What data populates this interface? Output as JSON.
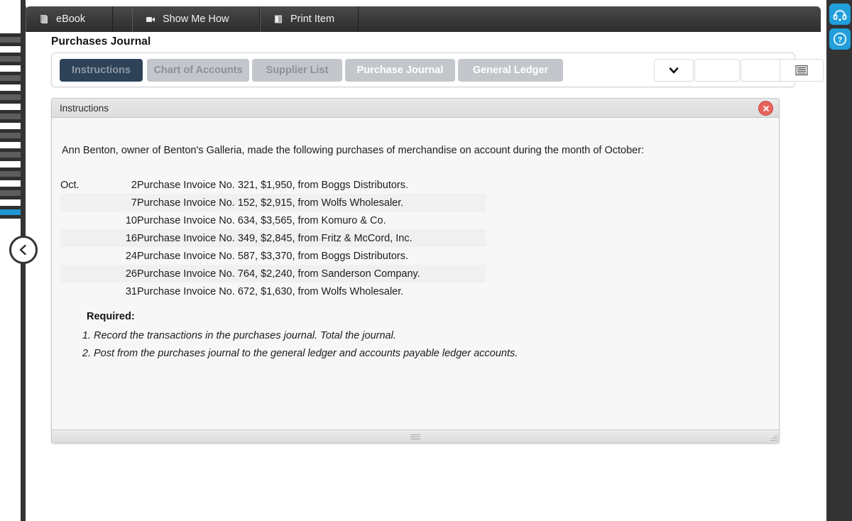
{
  "toolbar": {
    "items": [
      {
        "label": "eBook",
        "icon": "book-icon"
      },
      {
        "label": "Show Me How",
        "icon": "video-camera-icon"
      },
      {
        "label": "Print Item",
        "icon": "printer-icon"
      }
    ]
  },
  "page": {
    "title": "Purchases Journal"
  },
  "tabs": [
    {
      "label": "Instructions",
      "state": "selected"
    },
    {
      "label": "Chart of Accounts",
      "state": "dim"
    },
    {
      "label": "Supplier List",
      "state": "dim"
    },
    {
      "label": "Purchase Journal",
      "state": "light"
    },
    {
      "label": "General Ledger",
      "state": "light"
    }
  ],
  "tab_tools": [
    {
      "name": "chevron-down-button",
      "icon": "chevron-down-icon",
      "label": ""
    },
    {
      "name": "blank-button-1",
      "icon": "",
      "label": ""
    },
    {
      "name": "blank-button-2",
      "icon": "",
      "label": ""
    },
    {
      "name": "list-view-button",
      "icon": "list-icon",
      "label": ""
    }
  ],
  "panel": {
    "header": "Instructions",
    "close_label": "×",
    "intro": "Ann Benton, owner of Benton's Galleria, made the following purchases of merchandise on account during the month of October:",
    "transactions": [
      {
        "month": "Oct.",
        "day": "2",
        "description": "Purchase Invoice No. 321, $1,950, from Boggs Distributors."
      },
      {
        "month": "",
        "day": "7",
        "description": "Purchase Invoice No. 152, $2,915, from Wolfs Wholesaler."
      },
      {
        "month": "",
        "day": "10",
        "description": "Purchase Invoice No. 634, $3,565, from Komuro & Co."
      },
      {
        "month": "",
        "day": "16",
        "description": "Purchase Invoice No. 349, $2,845, from Fritz & McCord, Inc."
      },
      {
        "month": "",
        "day": "24",
        "description": "Purchase Invoice No. 587, $3,370, from Boggs Distributors."
      },
      {
        "month": "",
        "day": "26",
        "description": "Purchase Invoice No. 764, $2,240, from Sanderson Company."
      },
      {
        "month": "",
        "day": "31",
        "description": "Purchase Invoice No. 672, $1,630, from Wolfs Wholesaler."
      }
    ],
    "required_title": "Required:",
    "required_items": [
      "Record the transactions in the purchases journal. Total the journal.",
      "Post from the purchases journal to the general ledger and accounts payable ledger accounts."
    ]
  },
  "sidebar": {
    "segments": 10,
    "active_index": 9,
    "collapse_icon": "chevron-left-icon"
  },
  "right_rail": {
    "buttons": [
      {
        "name": "support-headset-button",
        "icon": "headset-icon"
      },
      {
        "name": "help-button",
        "icon": "question-circle-icon"
      }
    ]
  },
  "colors": {
    "accent_blue": "#229fdb",
    "tab_selected": "#2e4258",
    "tab_inactive": "#c3c7cc",
    "close_red": "#e8635c",
    "rail_dark": "#333333"
  }
}
